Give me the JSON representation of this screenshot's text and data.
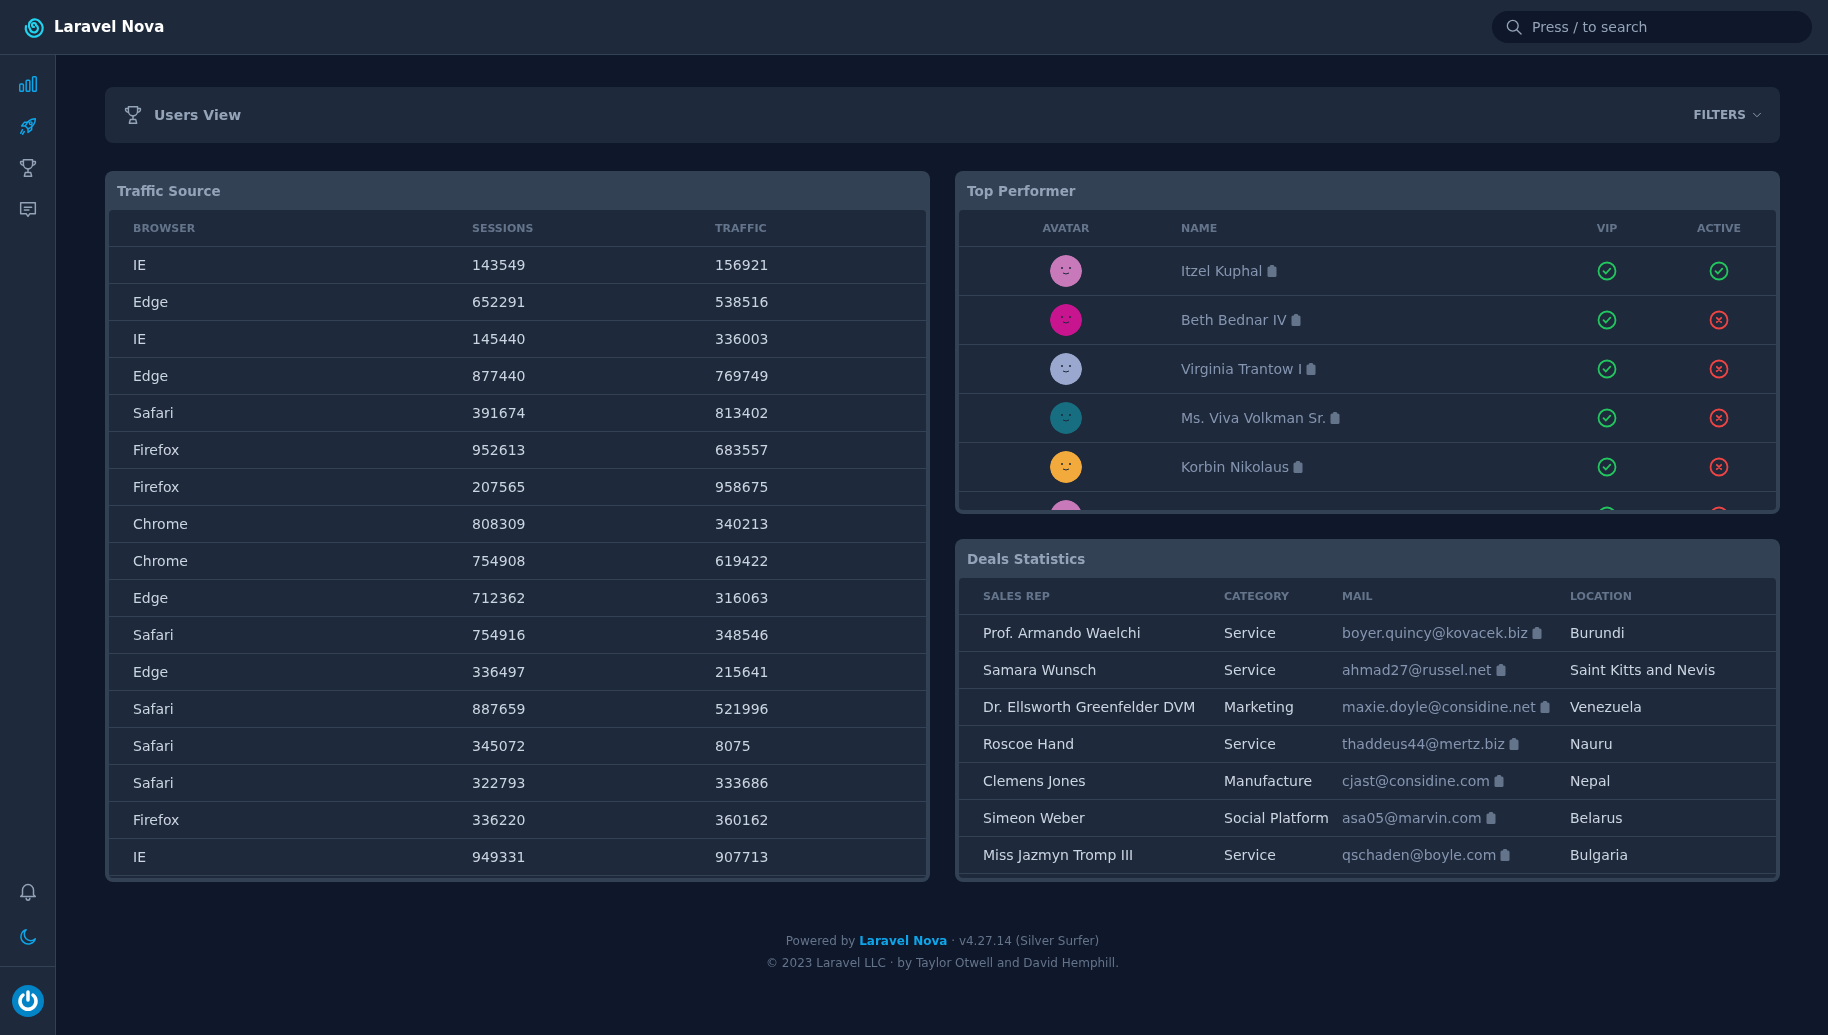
{
  "header": {
    "brand": "Laravel Nova",
    "search": {
      "placeholder": "Press / to search"
    }
  },
  "sidebar": {
    "items": [
      {
        "selected": true
      },
      {
        "selected": true
      },
      {
        "selected": false
      },
      {
        "selected": false
      }
    ],
    "bottom": [
      {
        "selected": false
      },
      {
        "selected": true
      }
    ]
  },
  "dashboard": {
    "title": "Users View",
    "filters": "FILTERS"
  },
  "traffic_source": {
    "title": "Traffic Source",
    "columns": [
      "BROWSER",
      "SESSIONS",
      "TRAFFIC"
    ],
    "rows": [
      [
        "IE",
        "143549",
        "156921"
      ],
      [
        "Edge",
        "652291",
        "538516"
      ],
      [
        "IE",
        "145440",
        "336003"
      ],
      [
        "Edge",
        "877440",
        "769749"
      ],
      [
        "Safari",
        "391674",
        "813402"
      ],
      [
        "Firefox",
        "952613",
        "683557"
      ],
      [
        "Firefox",
        "207565",
        "958675"
      ],
      [
        "Chrome",
        "808309",
        "340213"
      ],
      [
        "Chrome",
        "754908",
        "619422"
      ],
      [
        "Edge",
        "712362",
        "316063"
      ],
      [
        "Safari",
        "754916",
        "348546"
      ],
      [
        "Edge",
        "336497",
        "215641"
      ],
      [
        "Safari",
        "887659",
        "521996"
      ],
      [
        "Safari",
        "345072",
        "8075"
      ],
      [
        "Safari",
        "322793",
        "333686"
      ],
      [
        "Firefox",
        "336220",
        "360162"
      ],
      [
        "IE",
        "949331",
        "907713"
      ]
    ]
  },
  "top_performer": {
    "title": "Top Performer",
    "columns": [
      "AVATAR",
      "NAME",
      "VIP",
      "ACTIVE"
    ],
    "rows": [
      {
        "color": "#c879b9",
        "name": "Itzel Kuphal",
        "vip": true,
        "active": true
      },
      {
        "color": "#c8158f",
        "name": "Beth Bednar IV",
        "vip": true,
        "active": false
      },
      {
        "color": "#9aa8cf",
        "name": "Virginia Trantow I",
        "vip": true,
        "active": false
      },
      {
        "color": "#176e80",
        "name": "Ms. Viva Volkman Sr.",
        "vip": true,
        "active": false
      },
      {
        "color": "#f2aa3c",
        "name": "Korbin Nikolaus",
        "vip": true,
        "active": false
      },
      {
        "color": "#c879b9",
        "vip": true,
        "active": false
      }
    ]
  },
  "deals_statistics": {
    "title": "Deals Statistics",
    "columns": [
      "SALES REP",
      "CATEGORY",
      "MAIL",
      "LOCATION"
    ],
    "rows": [
      [
        "Prof. Armando Waelchi",
        "Service",
        "boyer.quincy@kovacek.biz",
        "Burundi"
      ],
      [
        "Samara Wunsch",
        "Service",
        "ahmad27@russel.net",
        "Saint Kitts and Nevis"
      ],
      [
        "Dr. Ellsworth Greenfelder DVM",
        "Marketing",
        "maxie.doyle@considine.net",
        "Venezuela"
      ],
      [
        "Roscoe Hand",
        "Service",
        "thaddeus44@mertz.biz",
        "Nauru"
      ],
      [
        "Clemens Jones",
        "Manufacture",
        "cjast@considine.com",
        "Nepal"
      ],
      [
        "Simeon Weber",
        "Social Platform",
        "asa05@marvin.com",
        "Belarus"
      ],
      [
        "Miss Jazmyn Tromp III",
        "Service",
        "qschaden@boyle.com",
        "Bulgaria"
      ]
    ]
  },
  "footer": {
    "powered_prefix": "Powered by",
    "powered_link": "Laravel Nova",
    "version": "· v4.27.14 (Silver Surfer)",
    "copyright": "© 2023 Laravel LLC · by Taylor Otwell and David Hemphill."
  }
}
